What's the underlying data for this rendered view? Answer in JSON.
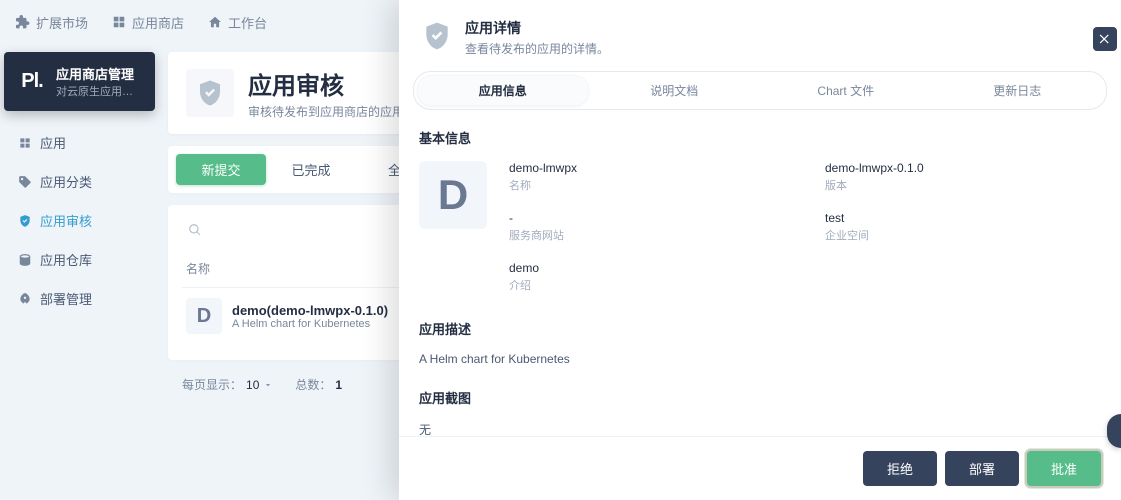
{
  "topnav": {
    "extend": "扩展市场",
    "store": "应用商店",
    "workbench": "工作台"
  },
  "sidebar": {
    "logo_text": "Pl.",
    "title": "应用商店管理",
    "subtitle": "对云原生应用的发布、…",
    "items": [
      {
        "label": "应用"
      },
      {
        "label": "应用分类"
      },
      {
        "label": "应用审核"
      },
      {
        "label": "应用仓库"
      },
      {
        "label": "部署管理"
      }
    ]
  },
  "page": {
    "title": "应用审核",
    "subtitle": "审核待发布到应用商店的应用。"
  },
  "tabs": {
    "new_submit": "新提交",
    "done": "已完成",
    "all": "全部"
  },
  "table": {
    "col_name": "名称",
    "rows": [
      {
        "icon_letter": "D",
        "title": "demo(demo-lmwpx-0.1.0)",
        "sub": "A Helm chart for Kubernetes"
      }
    ]
  },
  "pagination": {
    "per_page_label": "每页显示：",
    "per_page_value": "10",
    "total_label": "总数：",
    "total_value": "1"
  },
  "drawer": {
    "header_title": "应用详情",
    "header_subtitle": "查看待发布的应用的详情。",
    "tabs": {
      "info": "应用信息",
      "doc": "说明文档",
      "chart": "Chart 文件",
      "changelog": "更新日志"
    },
    "basic_title": "基本信息",
    "app_icon_letter": "D",
    "meta": {
      "name_val": "demo-lmwpx",
      "name_lbl": "名称",
      "ver_val": "demo-lmwpx-0.1.0",
      "ver_lbl": "版本",
      "site_val": "-",
      "site_lbl": "服务商网站",
      "ws_val": "test",
      "ws_lbl": "企业空间",
      "intro_val": "demo",
      "intro_lbl": "介绍"
    },
    "desc_title": "应用描述",
    "desc_text": "A Helm chart for Kubernetes",
    "shot_title": "应用截图",
    "shot_none": "无",
    "footer": {
      "reject": "拒绝",
      "deploy": "部署",
      "approve": "批准"
    }
  }
}
